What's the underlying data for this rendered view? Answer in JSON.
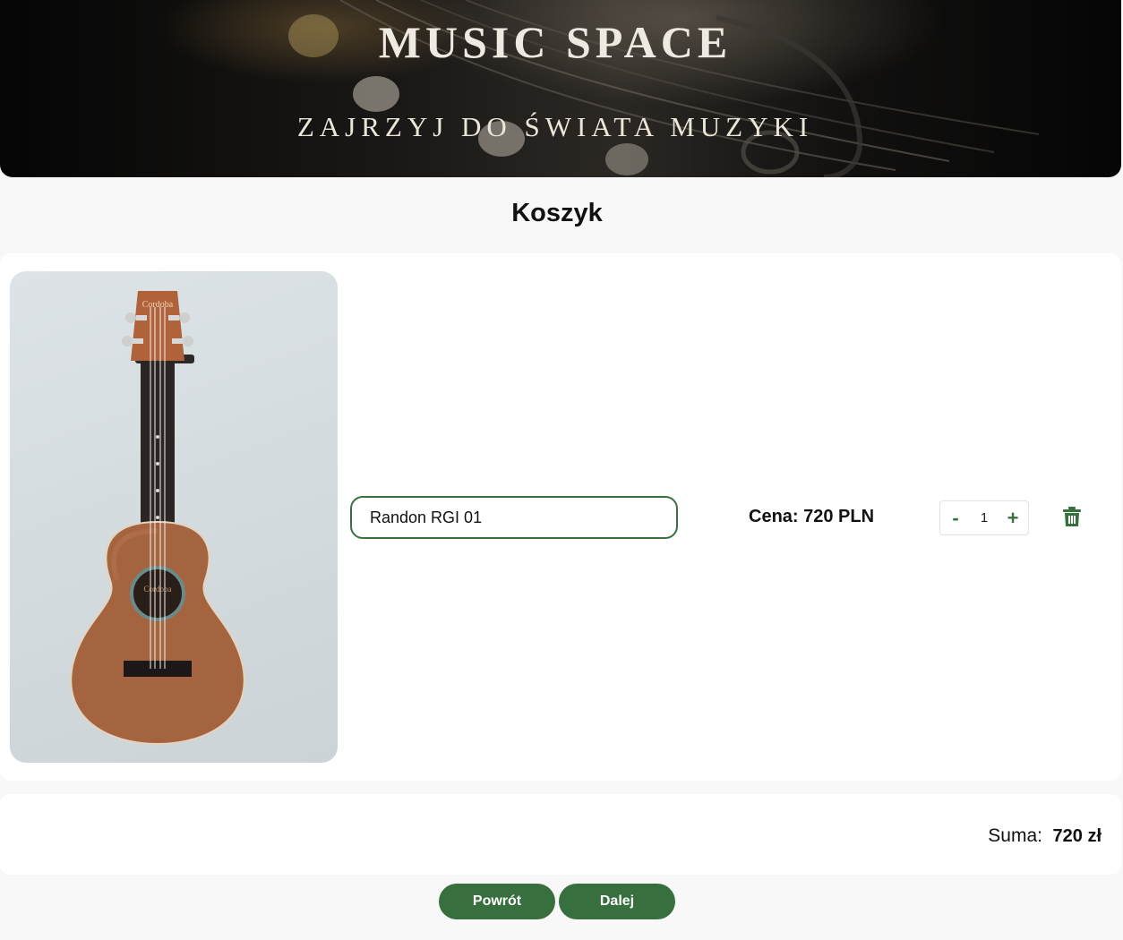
{
  "header": {
    "title": "MUSIC SPACE",
    "subtitle": "ZAJRZYJ DO ŚWIATA MUZYKI"
  },
  "page": {
    "title": "Koszyk"
  },
  "cart": {
    "items": [
      {
        "name": "Randon RGI 01",
        "price_label": "Cena: 720 PLN",
        "quantity": "1",
        "decrement_label": "-",
        "increment_label": "+",
        "image": "ukulele-photo",
        "image_brand_text": "Cordoba"
      }
    ]
  },
  "summary": {
    "label": "Suma:",
    "value": "720 zł"
  },
  "buttons": {
    "back_label": "Powrót",
    "next_label": "Dalej"
  },
  "icons": {
    "delete": "trash-icon"
  },
  "colors": {
    "accent": "#386f3e",
    "background": "#f8f8f8",
    "card": "#ffffff",
    "banner": "#0a0a0a"
  }
}
